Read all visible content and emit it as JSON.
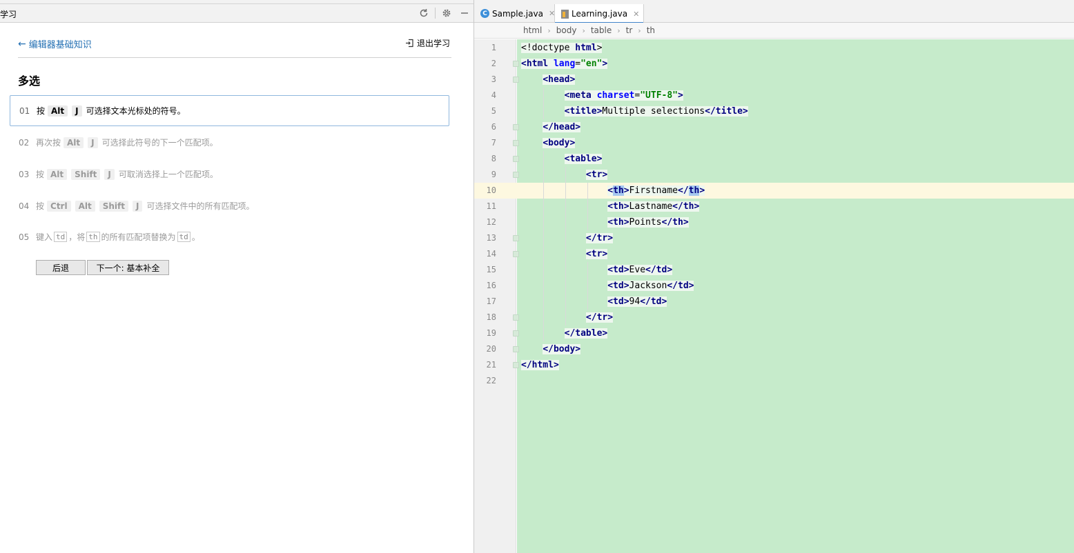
{
  "left_panel": {
    "title": "学习",
    "back_link": "编辑器基础知识",
    "exit_label": "退出学习",
    "lesson_title": "多选",
    "steps": [
      {
        "num": "01",
        "pre": "按",
        "keys": [
          "Alt",
          "J"
        ],
        "post": "可选择文本光标处的符号。"
      },
      {
        "num": "02",
        "pre": "再次按",
        "keys": [
          "Alt",
          "J"
        ],
        "post": "可选择此符号的下一个匹配项。"
      },
      {
        "num": "03",
        "pre": "按",
        "keys": [
          "Alt",
          "Shift",
          "J"
        ],
        "post": "可取消选择上一个匹配项。"
      },
      {
        "num": "04",
        "pre": "按",
        "keys": [
          "Ctrl",
          "Alt",
          "Shift",
          "J"
        ],
        "post": "可选择文件中的所有匹配项。"
      },
      {
        "num": "05",
        "pre": "键入",
        "chip1": "td",
        "mid1": "，将",
        "chip2": "th",
        "mid2": "的所有匹配项替换为",
        "chip3": "td",
        "post": "。"
      }
    ],
    "back_button": "后退",
    "next_button": "下一个: 基本补全"
  },
  "editor": {
    "tabs": [
      {
        "label": "Sample.java",
        "icon": "java-class-icon"
      },
      {
        "label": "Learning.java",
        "icon": "java-file-icon"
      }
    ],
    "breadcrumbs": [
      "html",
      "body",
      "table",
      "tr",
      "th"
    ],
    "line_numbers": [
      "1",
      "2",
      "3",
      "4",
      "5",
      "6",
      "7",
      "8",
      "9",
      "10",
      "11",
      "12",
      "13",
      "14",
      "15",
      "16",
      "17",
      "18",
      "19",
      "20",
      "21",
      "22"
    ],
    "current_line": 10,
    "code_text": {
      "l5_text": "Multiple selections",
      "l10_text": "Firstname",
      "l11_text": "Lastname",
      "l12_text": "Points",
      "l15_text": "Eve",
      "l16_text": "Jackson",
      "l17_text": "94"
    }
  },
  "colors": {
    "editor_bg": "#c6ebcb",
    "current_line": "#fdf8e0",
    "tag": "#000080",
    "attr": "#0000ff",
    "string": "#008000",
    "link": "#2470b3",
    "selection": "#a6c8ef"
  }
}
